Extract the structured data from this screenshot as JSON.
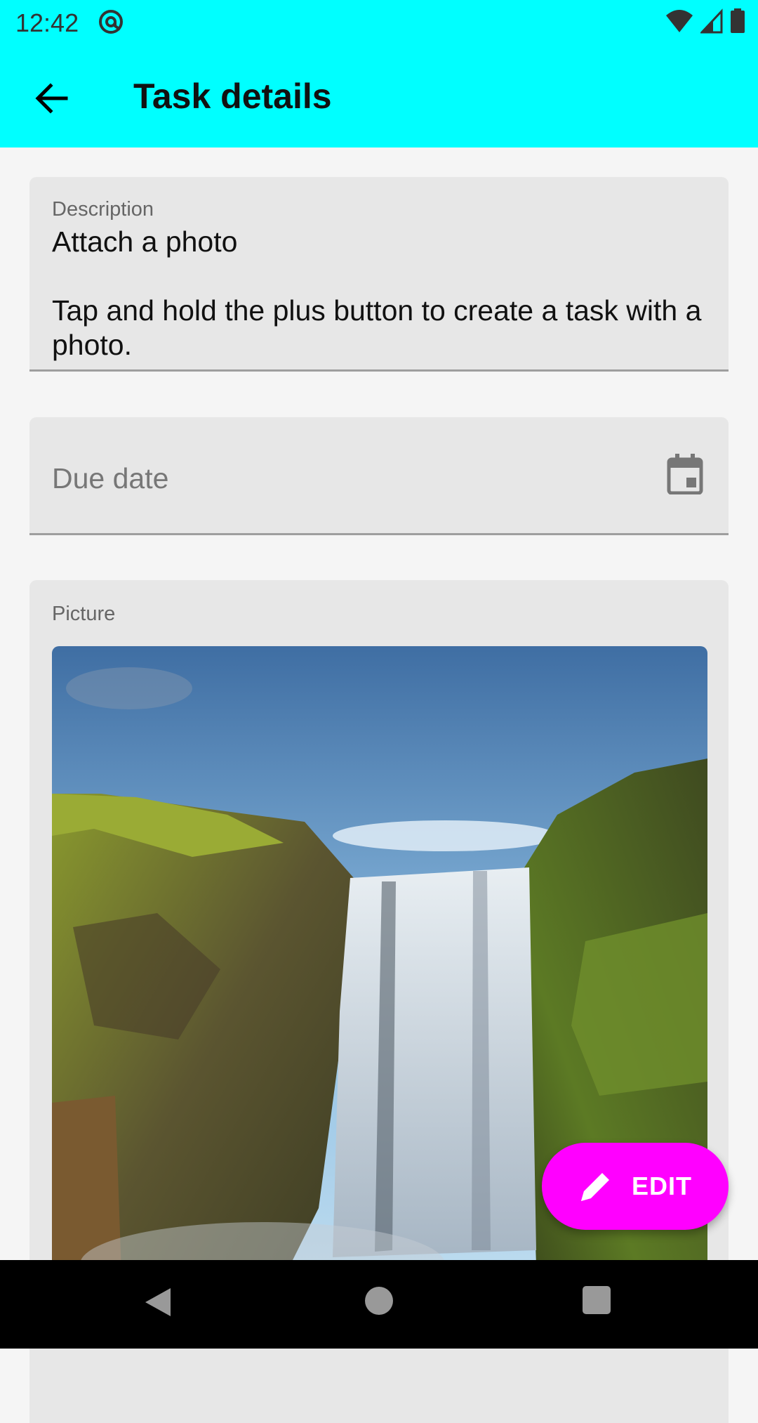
{
  "status_bar": {
    "time": "12:42"
  },
  "app_bar": {
    "title": "Task details"
  },
  "description": {
    "label": "Description",
    "value": "Attach a photo\n\nTap and hold the plus button to create a task with a photo."
  },
  "due_date": {
    "placeholder": "Due date"
  },
  "picture": {
    "label": "Picture"
  },
  "fab": {
    "label": "EDIT"
  },
  "colors": {
    "app_bar": "#00ffff",
    "fab": "#ff00ff",
    "field_bg": "#e7e7e7"
  }
}
